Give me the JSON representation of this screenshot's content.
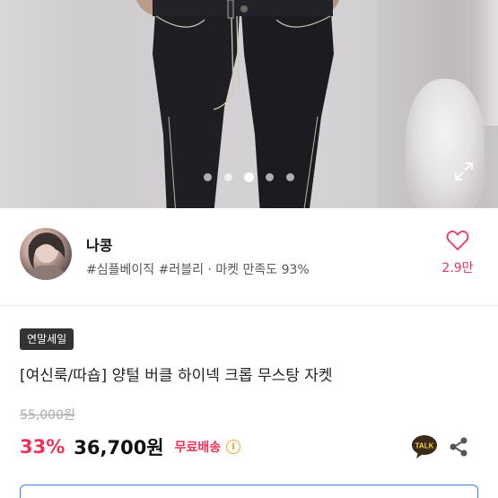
{
  "gallery": {
    "dots": 5,
    "active_index": 2,
    "icons": {
      "expand": "expand-icon"
    }
  },
  "seller": {
    "name": "나콩",
    "meta": "#심플베이직 #러블리 · 마켓 만족도 93%",
    "like_count": "2.9만",
    "icons": {
      "like": "heart-icon",
      "avatar": "avatar"
    }
  },
  "product": {
    "badge": "연말세일",
    "title": "[여신룩/따숍] 양털 버클 하이넥 크롭 무스탕 자켓",
    "original_price": "55,000원",
    "discount": "33%",
    "price": "36,700원",
    "shipping": "무료배송",
    "icons": {
      "info": "info-icon",
      "talk": "talk-icon",
      "share": "share-icon"
    }
  },
  "colors": {
    "accent": "#f0315b",
    "badge_bg": "#333333",
    "info_icon": "#f5a623",
    "talk_bg": "#3a2a1a",
    "talk_text": "#f7d53b"
  }
}
